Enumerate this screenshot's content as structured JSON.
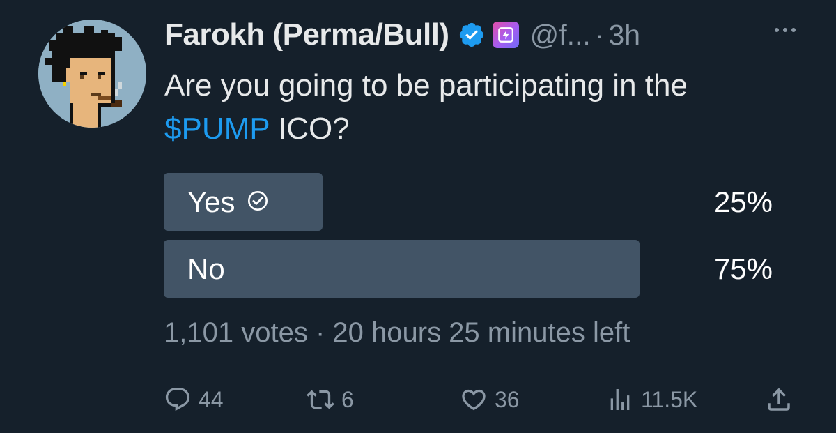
{
  "tweet": {
    "author_name": "Farokh (Perma/Bull)",
    "handle": "@f...",
    "separator": "·",
    "time": "3h",
    "text_line1": "Are you going to be participating in the",
    "cashtag": "$PUMP",
    "text_rest": " ICO?"
  },
  "poll": {
    "options": [
      {
        "label": "Yes",
        "percent": "25%",
        "fraction": 0.25,
        "selected": true
      },
      {
        "label": "No",
        "percent": "75%",
        "fraction": 0.75,
        "selected": false
      }
    ],
    "votes": "1,101 votes",
    "separator": "·",
    "time_left": "20 hours 25 minutes left"
  },
  "actions": {
    "replies": "44",
    "reposts": "6",
    "likes": "36",
    "views": "11.5K"
  },
  "icons": {
    "verified": "verified-badge-icon",
    "app_badge": "lightning-badge-icon",
    "more": "more-dots-icon",
    "reply": "reply-icon",
    "repost": "repost-icon",
    "like": "heart-icon",
    "views": "views-chart-icon",
    "share": "share-icon",
    "check": "check-circle-icon"
  },
  "colors": {
    "background": "#15202b",
    "accent": "#1d9bf0",
    "poll_bar": "#425466",
    "muted": "#8b98a5"
  }
}
